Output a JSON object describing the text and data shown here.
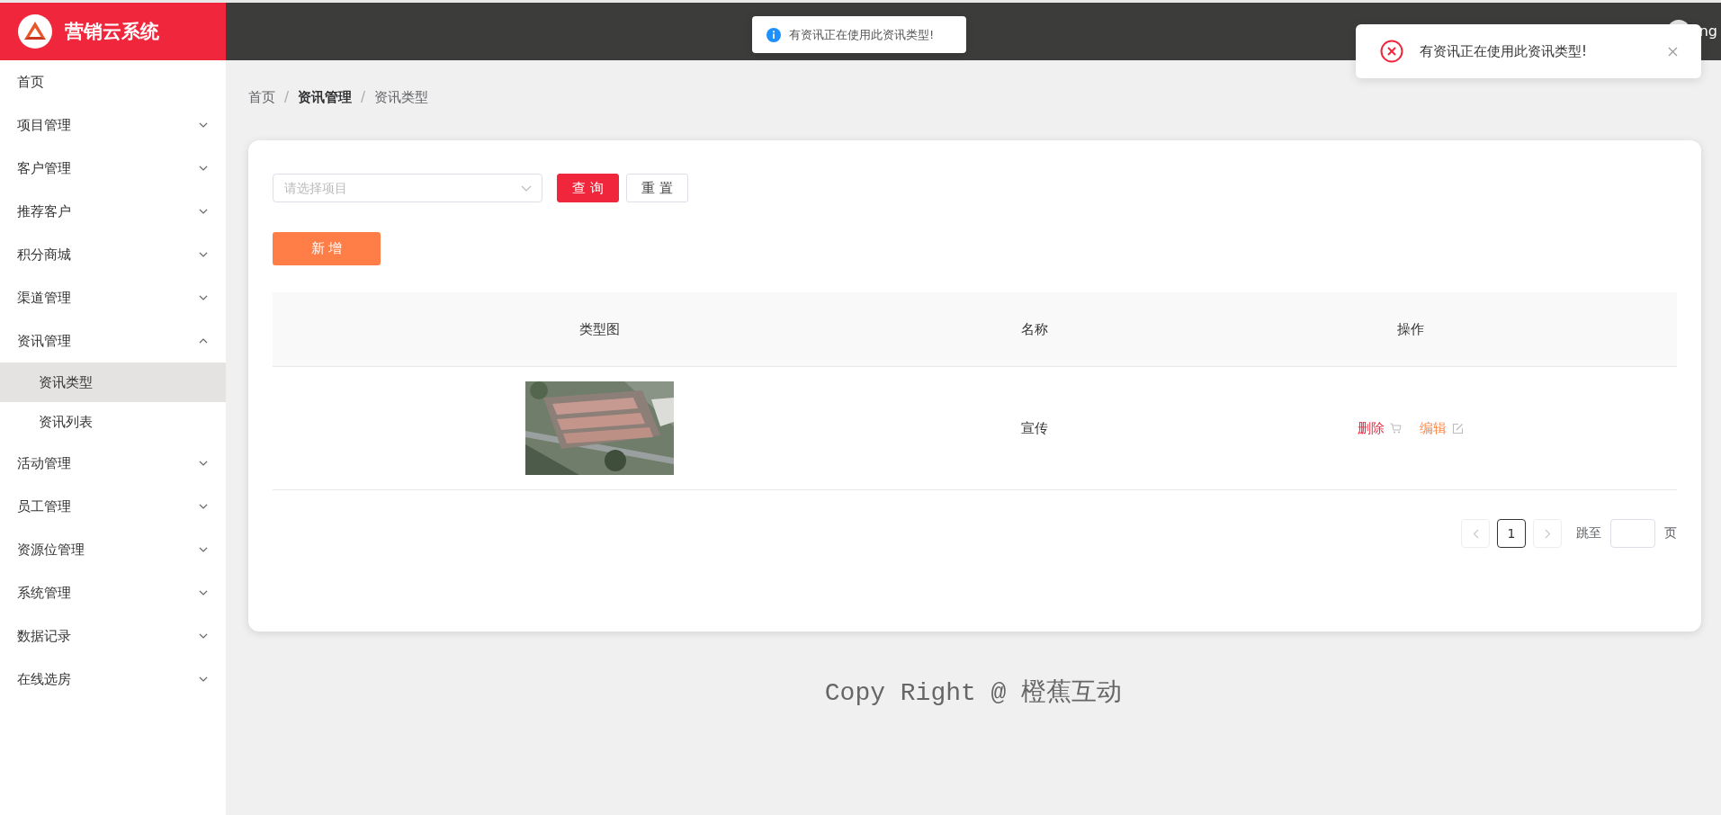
{
  "app": {
    "title": "营销云系统"
  },
  "header": {
    "user_name": "ng"
  },
  "sidebar": {
    "items": [
      {
        "label": "首页",
        "kind": "link"
      },
      {
        "label": "项目管理",
        "kind": "menu",
        "expanded": false
      },
      {
        "label": "客户管理",
        "kind": "menu",
        "expanded": false
      },
      {
        "label": "推荐客户",
        "kind": "menu",
        "expanded": false
      },
      {
        "label": "积分商城",
        "kind": "menu",
        "expanded": false
      },
      {
        "label": "渠道管理",
        "kind": "menu",
        "expanded": false
      },
      {
        "label": "资讯管理",
        "kind": "menu",
        "expanded": true,
        "children": [
          {
            "label": "资讯类型",
            "selected": true
          },
          {
            "label": "资讯列表",
            "selected": false
          }
        ]
      },
      {
        "label": "活动管理",
        "kind": "menu",
        "expanded": false
      },
      {
        "label": "员工管理",
        "kind": "menu",
        "expanded": false
      },
      {
        "label": "资源位管理",
        "kind": "menu",
        "expanded": false
      },
      {
        "label": "系统管理",
        "kind": "menu",
        "expanded": false
      },
      {
        "label": "数据记录",
        "kind": "menu",
        "expanded": false
      },
      {
        "label": "在线选房",
        "kind": "menu",
        "expanded": false
      }
    ]
  },
  "breadcrumb": [
    {
      "label": "首页",
      "kind": "link"
    },
    {
      "label": "/",
      "kind": "separator"
    },
    {
      "label": "资讯管理",
      "kind": "strong"
    },
    {
      "label": "/",
      "kind": "separator"
    },
    {
      "label": "资讯类型",
      "kind": "current"
    }
  ],
  "filter": {
    "project_select": {
      "placeholder": "请选择项目"
    },
    "search_button": "查 询",
    "reset_button": "重 置"
  },
  "add_button": "新 增",
  "table": {
    "columns": [
      "类型图",
      "名称",
      "操作"
    ],
    "rows": [
      {
        "image": {
          "kind": "picture"
        },
        "name": "宣传",
        "actions": [
          {
            "label": "删除",
            "kind": "delete"
          },
          {
            "label": "编辑",
            "kind": "edit"
          }
        ]
      }
    ]
  },
  "pagination": {
    "prev_disabled": true,
    "next_disabled": true,
    "pages": [
      {
        "label": "1",
        "selected": true
      }
    ],
    "jump_label": "跳至",
    "page_suffix": "页"
  },
  "footer": "Copy Right @ 橙蕉互动",
  "message": {
    "kind": "info",
    "text": "有资讯正在使用此资讯类型!"
  },
  "notification": {
    "kind": "error",
    "text": "有资讯正在使用此资讯类型!",
    "closable": true
  }
}
